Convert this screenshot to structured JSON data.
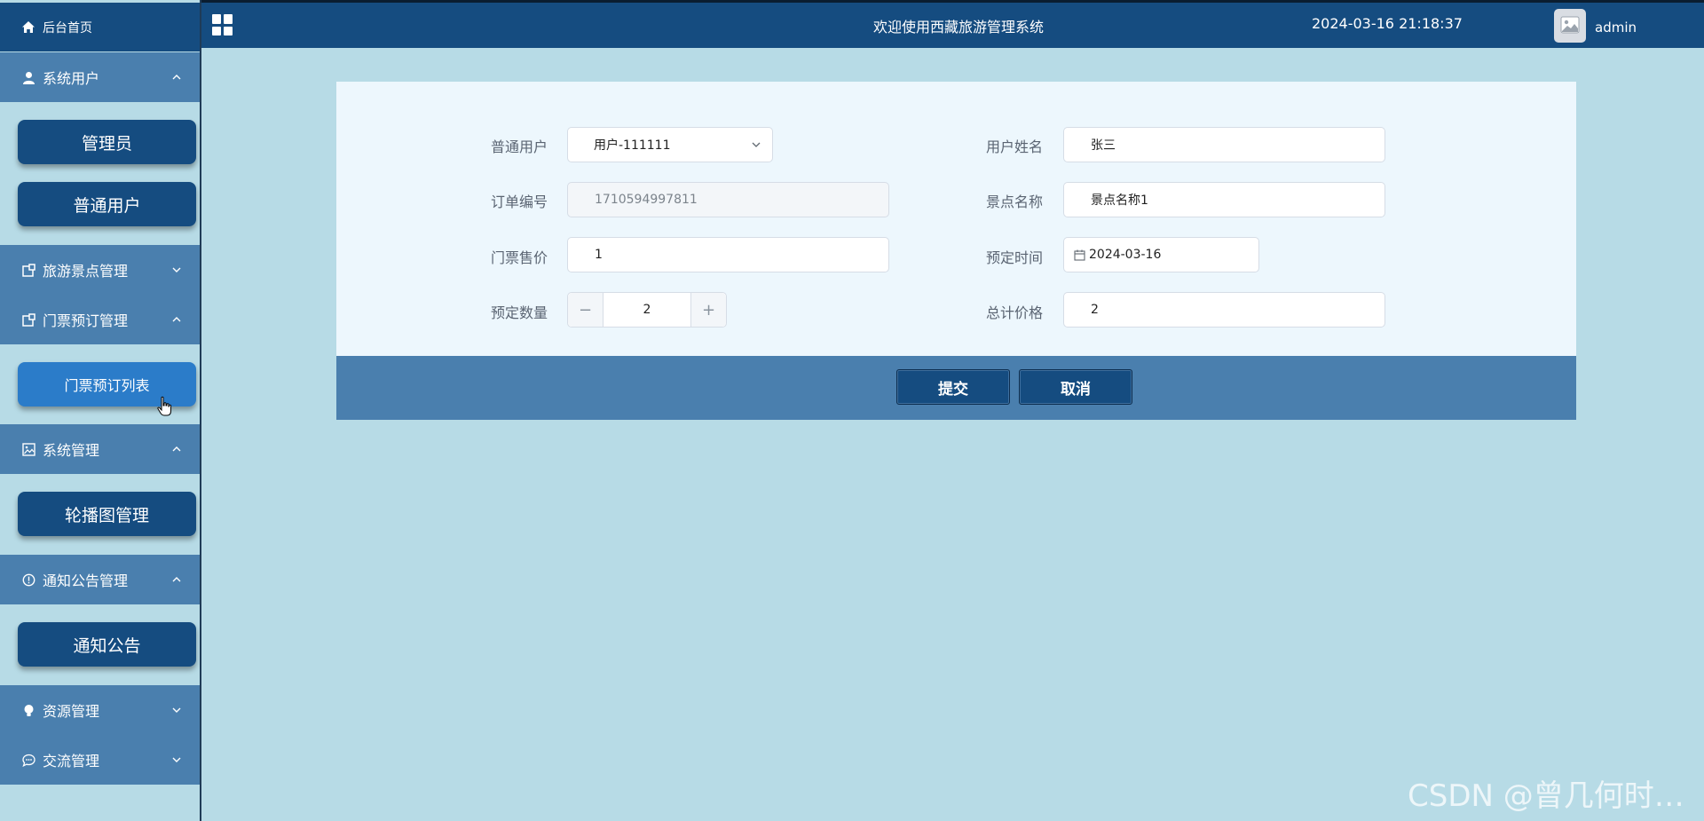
{
  "header": {
    "title": "欢迎使用西藏旅游管理系统",
    "datetime": "2024-03-16 21:18:37",
    "username": "admin"
  },
  "sidebar": {
    "home": "后台首页",
    "groups": [
      {
        "label": "系统用户",
        "icon": "user-icon",
        "expanded": true,
        "items": [
          "管理员",
          "普通用户"
        ]
      },
      {
        "label": "旅游景点管理",
        "icon": "window-icon",
        "expanded": false,
        "items": []
      },
      {
        "label": "门票预订管理",
        "icon": "window-icon",
        "expanded": true,
        "items": [
          "门票预订列表"
        ]
      },
      {
        "label": "系统管理",
        "icon": "picture-icon",
        "expanded": true,
        "items": [
          "轮播图管理"
        ]
      },
      {
        "label": "通知公告管理",
        "icon": "warning-icon",
        "expanded": true,
        "items": [
          "通知公告"
        ]
      },
      {
        "label": "资源管理",
        "icon": "bulb-icon",
        "expanded": false,
        "items": []
      },
      {
        "label": "交流管理",
        "icon": "chat-icon",
        "expanded": false,
        "items": []
      }
    ]
  },
  "form": {
    "user_label": "普通用户",
    "user_value": "用户-111111",
    "name_label": "用户姓名",
    "name_value": "张三",
    "order_label": "订单编号",
    "order_value": "1710594997811",
    "spot_label": "景点名称",
    "spot_value": "景点名称1",
    "price_label": "门票售价",
    "price_value": "1",
    "date_label": "预定时间",
    "date_value": "2024-03-16",
    "qty_label": "预定数量",
    "qty_value": "2",
    "qty_minus": "−",
    "qty_plus": "+",
    "total_label": "总计价格",
    "total_value": "2",
    "submit_label": "提交",
    "cancel_label": "取消"
  },
  "watermark": "CSDN @曾几何时…",
  "colors": {
    "header_bg": "#154c80",
    "menu_bg": "#4a7fae",
    "page_bg": "#b7dbe6",
    "active_item": "#2b7cc9"
  }
}
